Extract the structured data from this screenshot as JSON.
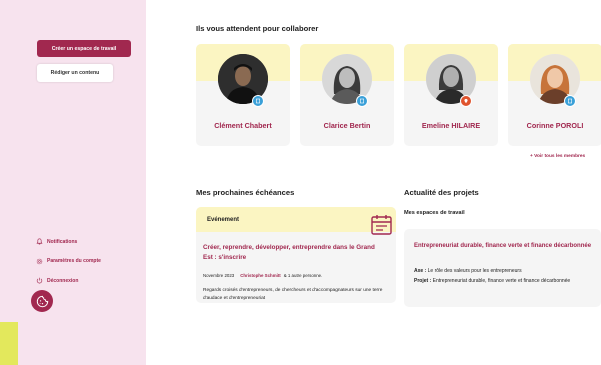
{
  "sidebar": {
    "create_workspace_label": "Créer un espace de travail",
    "write_content_label": "Rédiger un contenu",
    "menu": [
      {
        "label": "Notifications",
        "icon": "bell-icon"
      },
      {
        "label": "Paramètres du compte",
        "icon": "gear-icon"
      },
      {
        "label": "Déconnexion",
        "icon": "power-icon"
      }
    ],
    "cookie_icon": "cookie-icon"
  },
  "collaborators": {
    "title": "Ils vous attendent pour collaborer",
    "see_all": "+ Voir tous les membres",
    "members": [
      {
        "name": "Clément Chabert",
        "badge_color": "#3aa0d8"
      },
      {
        "name": "Clarice Bertin",
        "badge_color": "#3aa0d8"
      },
      {
        "name": "Emeline HILAIRE",
        "badge_color": "#e0542e"
      },
      {
        "name": "Corinne POROLI",
        "badge_color": "#3aa0d8"
      }
    ]
  },
  "deadlines": {
    "title": "Mes prochaines échéances",
    "event": {
      "type_label": "Evénement",
      "title": "Créer, reprendre, développer, entreprendre dans le Grand Est : s'inscrire",
      "date": "Novembre 2023",
      "author": "Christophe Schmitt",
      "others": "& 1 autre personne.",
      "description": "Regards croisés d'entrepreneurs, de chercheurs et d'accompagnateurs sur une terre d'audace et d'entrepreneuriat"
    }
  },
  "projects": {
    "title": "Actualité des projets",
    "subtitle": "Mes espaces de travail",
    "card": {
      "title": "Entrepreneuriat durable, finance verte et finance décarbonnée",
      "axe_label": "Axe :",
      "axe_value": "Le rôle des valeurs pour les entrepreneurs",
      "projet_label": "Projet :",
      "projet_value": "Entrepreneuriat durable, finance verte et finance décarbonnée"
    }
  },
  "colors": {
    "accent": "#a1284f",
    "sidebar_bg": "#f7e3ee",
    "card_band": "#fbf5c2"
  }
}
